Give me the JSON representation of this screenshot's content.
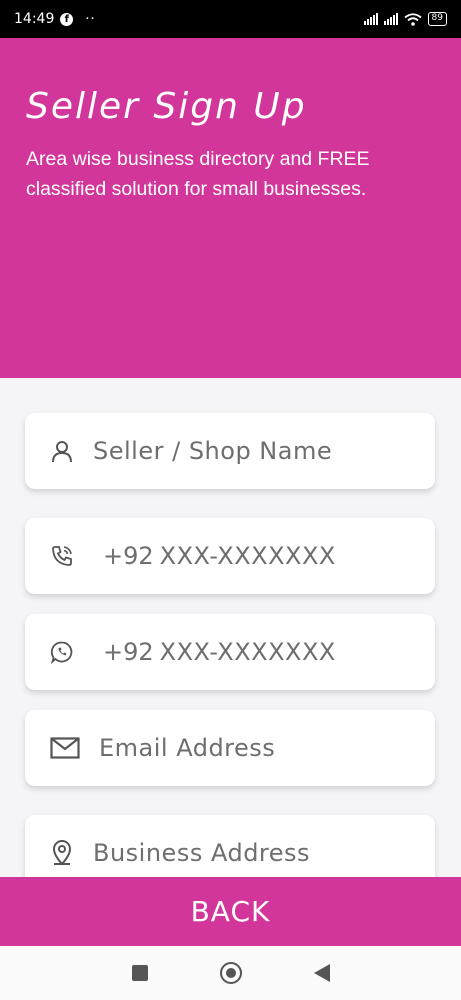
{
  "status_bar": {
    "time": "14:49",
    "fb_icon": "f",
    "dots": "··",
    "battery": "89"
  },
  "header": {
    "title": "Seller Sign Up",
    "subtitle": "Area wise business directory and FREE classified solution for small businesses.",
    "color": "#d2369b"
  },
  "form": {
    "shop_name_placeholder": "Seller / Shop Name",
    "phone_prefix": "+92",
    "phone_placeholder": "XXX-XXXXXXX",
    "whatsapp_prefix": "+92",
    "whatsapp_placeholder": "XXX-XXXXXXX",
    "email_placeholder": "Email Address",
    "address_placeholder": "Business Address"
  },
  "footer": {
    "back_label": "BACK"
  }
}
